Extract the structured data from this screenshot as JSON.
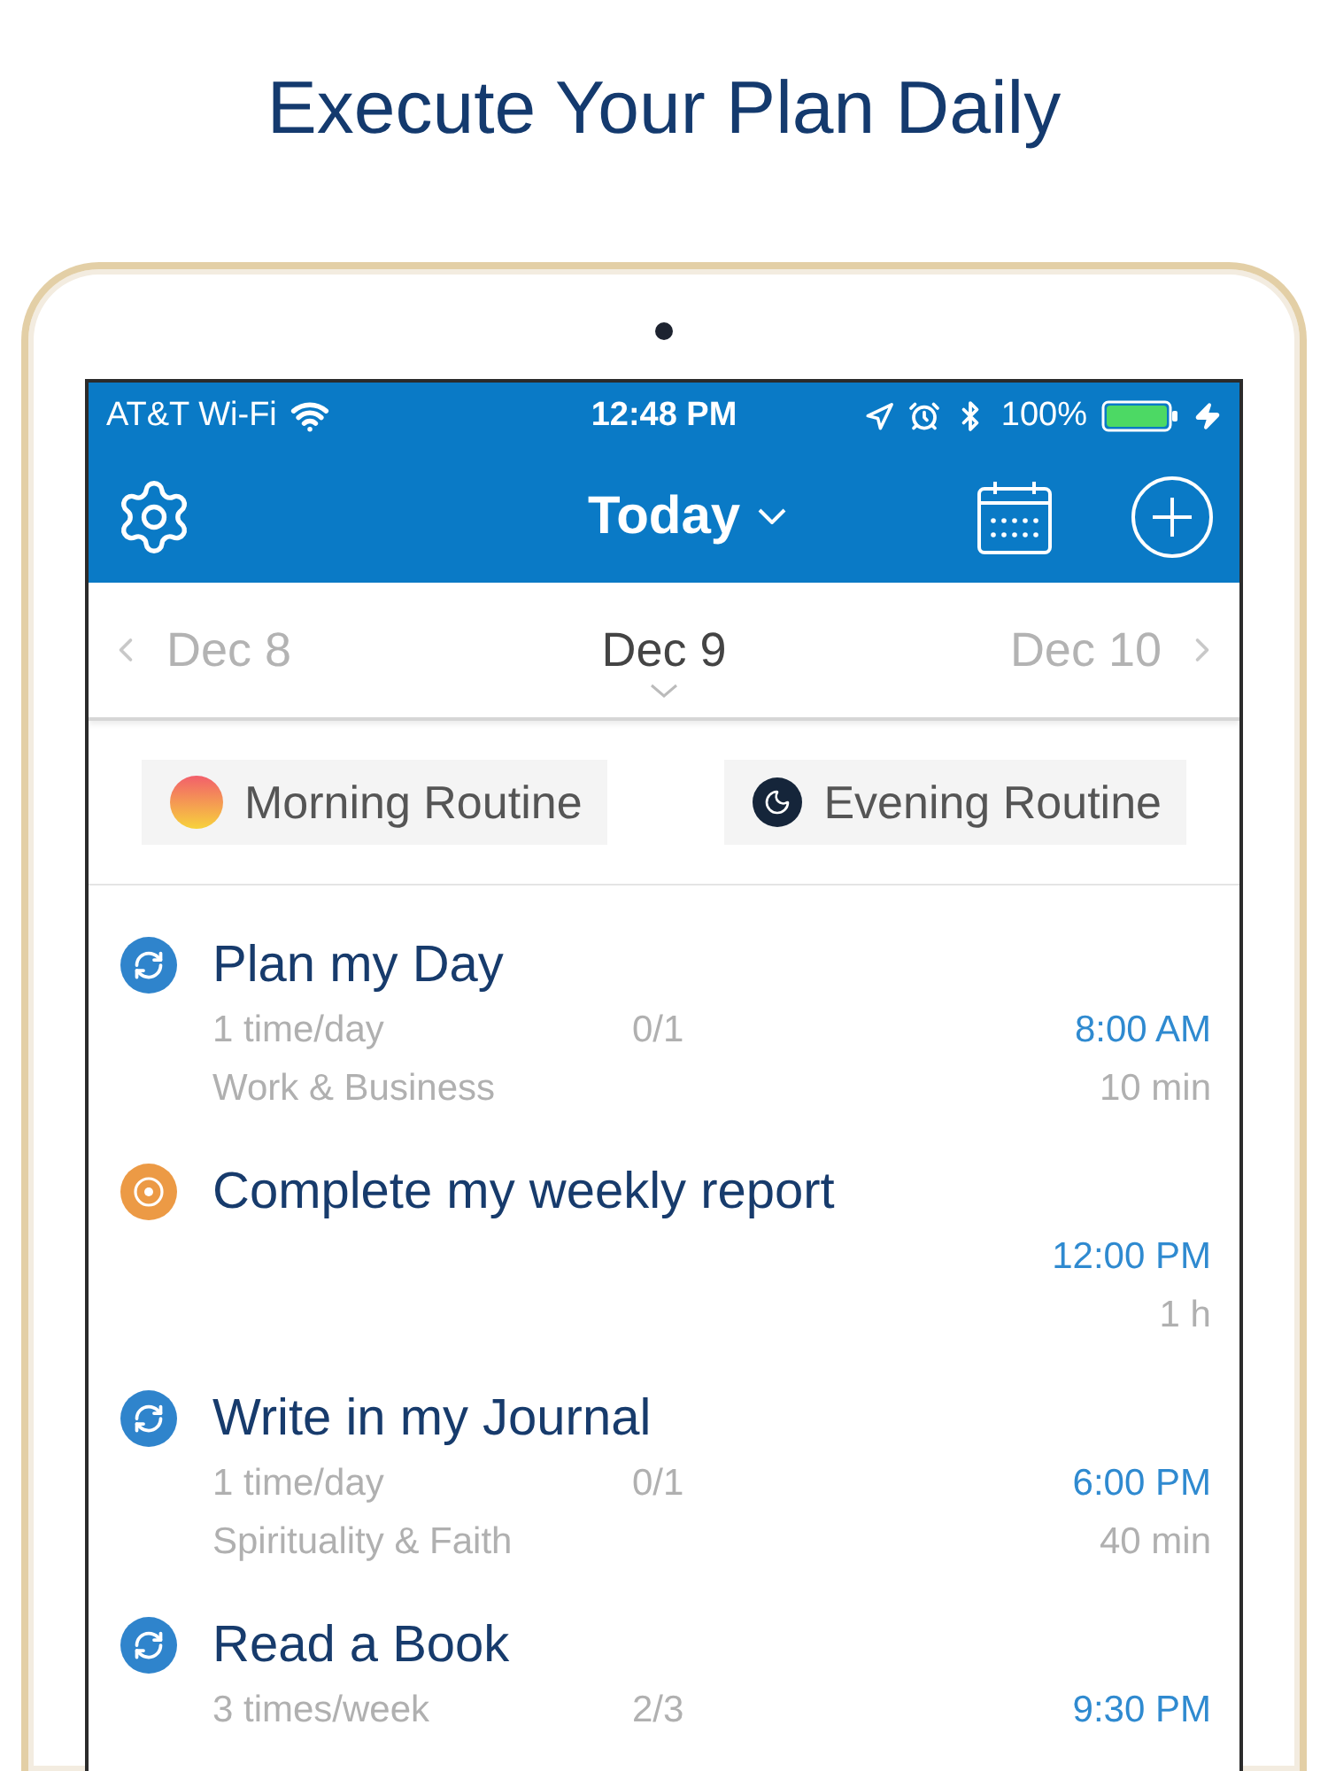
{
  "headline": "Execute Your Plan Daily",
  "status_bar": {
    "carrier": "AT&T Wi-Fi",
    "time": "12:48 PM",
    "battery": "100%"
  },
  "nav_bar": {
    "title": "Today"
  },
  "dates": [
    {
      "label": "Dec 8",
      "selected": false
    },
    {
      "label": "Dec 9",
      "selected": true
    },
    {
      "label": "Dec 10",
      "selected": false
    }
  ],
  "routines": [
    {
      "label": "Morning Routine",
      "kind": "morning"
    },
    {
      "label": "Evening Routine",
      "kind": "evening"
    }
  ],
  "tasks": [
    {
      "title": "Plan my Day",
      "kind": "habit",
      "frequency": "1 time/day",
      "progress": "0/1",
      "category": "Work & Business",
      "time": "8:00 AM",
      "duration": "10 min"
    },
    {
      "title": "Complete my weekly report",
      "kind": "task",
      "time": "12:00 PM",
      "duration": "1 h"
    },
    {
      "title": "Write in my Journal",
      "kind": "habit",
      "frequency": "1 time/day",
      "progress": "0/1",
      "category": "Spirituality & Faith",
      "time": "6:00 PM",
      "duration": "40 min"
    },
    {
      "title": "Read a Book",
      "kind": "habit",
      "frequency": "3 times/week",
      "progress": "2/3",
      "time": "9:30 PM"
    }
  ]
}
